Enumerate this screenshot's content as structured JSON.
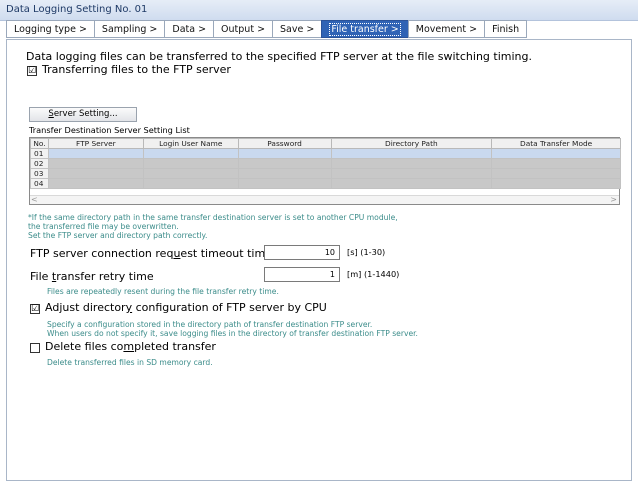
{
  "window": {
    "title": "Data Logging Setting No. 01"
  },
  "tabs": [
    {
      "label": "Logging type >",
      "active": false
    },
    {
      "label": "Sampling >",
      "active": false
    },
    {
      "label": "Data >",
      "active": false
    },
    {
      "label": "Output >",
      "active": false
    },
    {
      "label": "Save >",
      "active": false
    },
    {
      "label": "File transfer >",
      "active": true
    },
    {
      "label": "Movement >",
      "active": false
    },
    {
      "label": "Finish",
      "active": false
    }
  ],
  "intro": {
    "text": "Data logging files can be transferred to the specified FTP server at the file switching timing.",
    "transfer_checkbox_checked": true,
    "transfer_label_pre": "Transferring f",
    "transfer_label_ul": "i",
    "transfer_label_post": "les to the FTP server"
  },
  "server_setting": {
    "button_pre": "",
    "button_ul": "S",
    "button_post": "erver Setting..."
  },
  "list": {
    "title": "Transfer Destination Server Setting List",
    "columns": [
      "No.",
      "FTP Server",
      "Login User Name",
      "Password",
      "Directory Path",
      "Data Transfer Mode"
    ],
    "rows": [
      "01",
      "02",
      "03",
      "04"
    ],
    "scroll_left": "<",
    "scroll_right": ">"
  },
  "warning": {
    "line1": "*If the same directory path in the same transfer destination server is set to another CPU module,",
    "line2": "the transferred file may be overwritten.",
    "line3": "Set the FTP server and directory path correctly."
  },
  "timeout": {
    "label_pre": "FTP server connection req",
    "label_ul": "u",
    "label_post": "est timeout time",
    "value": "10",
    "unit": "[s] (1-30)"
  },
  "retry": {
    "label_pre": "File ",
    "label_ul": "t",
    "label_post": "ransfer retry time",
    "value": "1",
    "unit": "[m] (1-1440)",
    "note": "Files are repeatedly resent during the file transfer retry time."
  },
  "adjust": {
    "checked": true,
    "label_pre": "Adjust director",
    "label_ul": "y",
    "label_post": " configuration of FTP server by CPU",
    "note1": "Specify a configuration stored in the directory path of transfer destination FTP server.",
    "note2": "When users do not specify it, save logging files in the directory of transfer destination FTP server."
  },
  "delete": {
    "checked": false,
    "label_pre": "Delete files co",
    "label_ul": "m",
    "label_post": "pleted transfer",
    "note": "Delete transferred files in SD memory card."
  },
  "check_glyph": "☑"
}
